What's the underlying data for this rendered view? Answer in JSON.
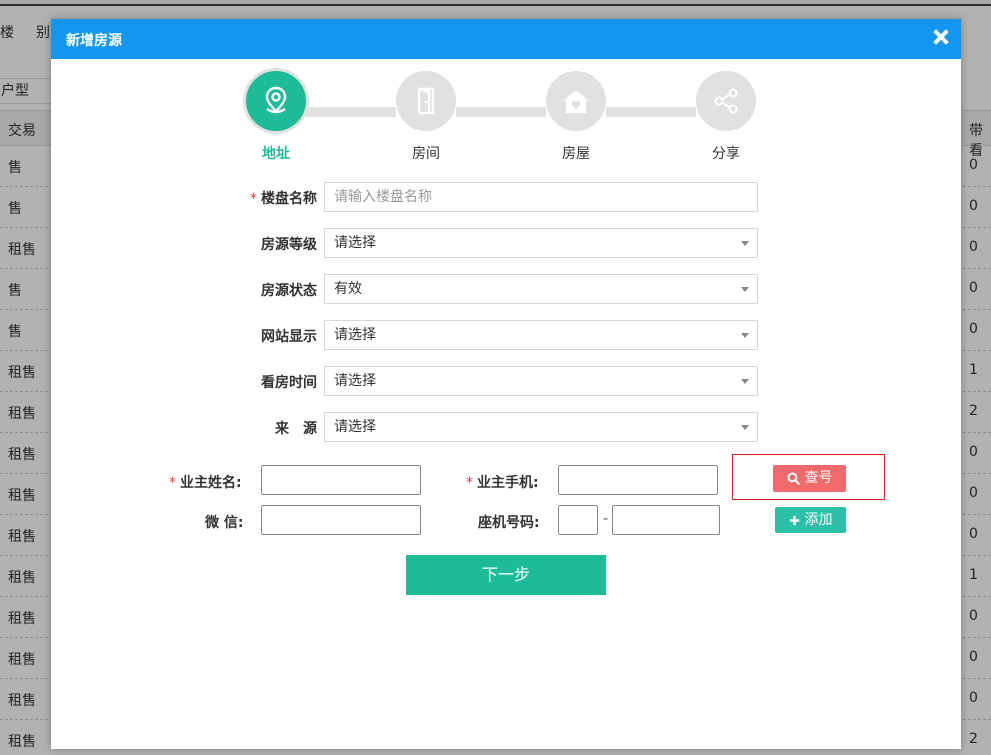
{
  "background": {
    "nav": [
      "楼",
      "别"
    ],
    "filter_label": "户型",
    "table_headers": {
      "trade": "交易",
      "right": "带看"
    },
    "rows": [
      {
        "trade": "售",
        "count": "0"
      },
      {
        "trade": "售",
        "count": "0"
      },
      {
        "trade": "租售",
        "count": "0"
      },
      {
        "trade": "售",
        "count": "0"
      },
      {
        "trade": "售",
        "count": "0"
      },
      {
        "trade": "租售",
        "count": "1"
      },
      {
        "trade": "租售",
        "count": "2"
      },
      {
        "trade": "租售",
        "count": "0"
      },
      {
        "trade": "租售",
        "count": "0"
      },
      {
        "trade": "租售",
        "count": "0"
      },
      {
        "trade": "租售",
        "count": "1"
      },
      {
        "trade": "租售",
        "count": "0"
      },
      {
        "trade": "租售",
        "count": "0"
      },
      {
        "trade": "租售",
        "count": "0"
      },
      {
        "trade": "租售",
        "count": "2"
      }
    ]
  },
  "modal": {
    "title": "新增房源",
    "close_icon": "close-icon",
    "header_color": "#1296f0"
  },
  "steps": [
    {
      "label": "地址",
      "icon": "location-pin-icon",
      "active": true
    },
    {
      "label": "房间",
      "icon": "door-icon",
      "active": false
    },
    {
      "label": "房屋",
      "icon": "house-heart-icon",
      "active": false
    },
    {
      "label": "分享",
      "icon": "share-icon",
      "active": false
    }
  ],
  "form": {
    "building": {
      "label": "楼盘名称",
      "placeholder": "请输入楼盘名称",
      "value": "",
      "required": true
    },
    "grade": {
      "label": "房源等级",
      "value": "请选择"
    },
    "status": {
      "label": "房源状态",
      "value": "有效"
    },
    "website": {
      "label": "网站显示",
      "value": "请选择"
    },
    "viewing": {
      "label": "看房时间",
      "value": "请选择"
    },
    "source": {
      "label": "来　源",
      "value": "请选择"
    }
  },
  "owner": {
    "name_label": "业主姓名:",
    "phone_label": "业主手机:",
    "wechat_label": "微 信:",
    "landline_label": "座机号码:",
    "landline_sep": "-",
    "check_label": "查号",
    "add_label": "添加"
  },
  "next_label": "下一步",
  "colors": {
    "accent": "#1dbb97",
    "danger": "#f0696b",
    "add": "#2dc0a8",
    "required": "#e4393c"
  }
}
